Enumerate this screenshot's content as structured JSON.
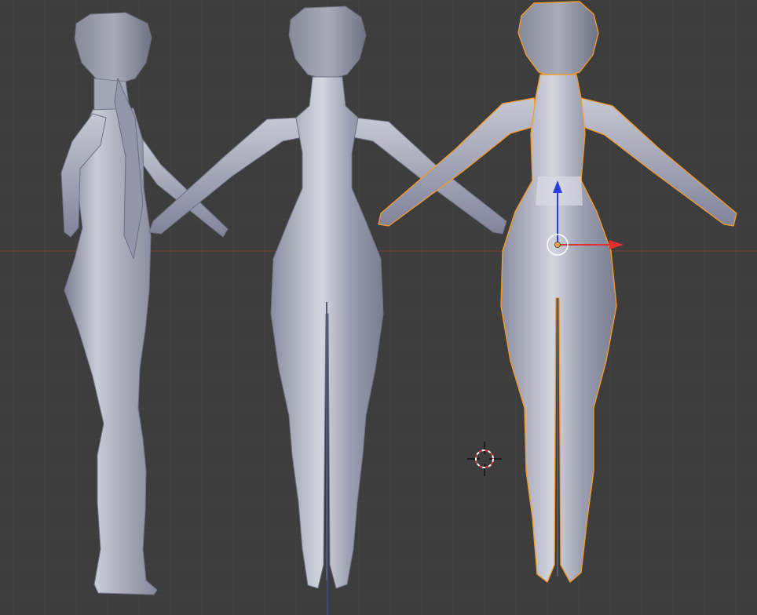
{
  "viewport": {
    "background": "#3d3d3d",
    "grid_line_color": "#444444",
    "x_axis_color": "#8a3535",
    "y_axis_color": "#3c4f86"
  },
  "scene": {
    "figures": [
      {
        "name": "side-view-figure",
        "selected": false
      },
      {
        "name": "back-view-figure",
        "selected": false
      },
      {
        "name": "front-view-figure",
        "selected": true
      }
    ],
    "mesh_color": "#a8abbd",
    "selection_outline_color": "#f39a2c"
  },
  "gizmo": {
    "x_color": "#e0312d",
    "z_color": "#2b3fe0",
    "origin_color": "#f3a33a"
  },
  "cursor_3d": {
    "ring_color_a": "#d23b3b",
    "ring_color_b": "#ffffff"
  }
}
